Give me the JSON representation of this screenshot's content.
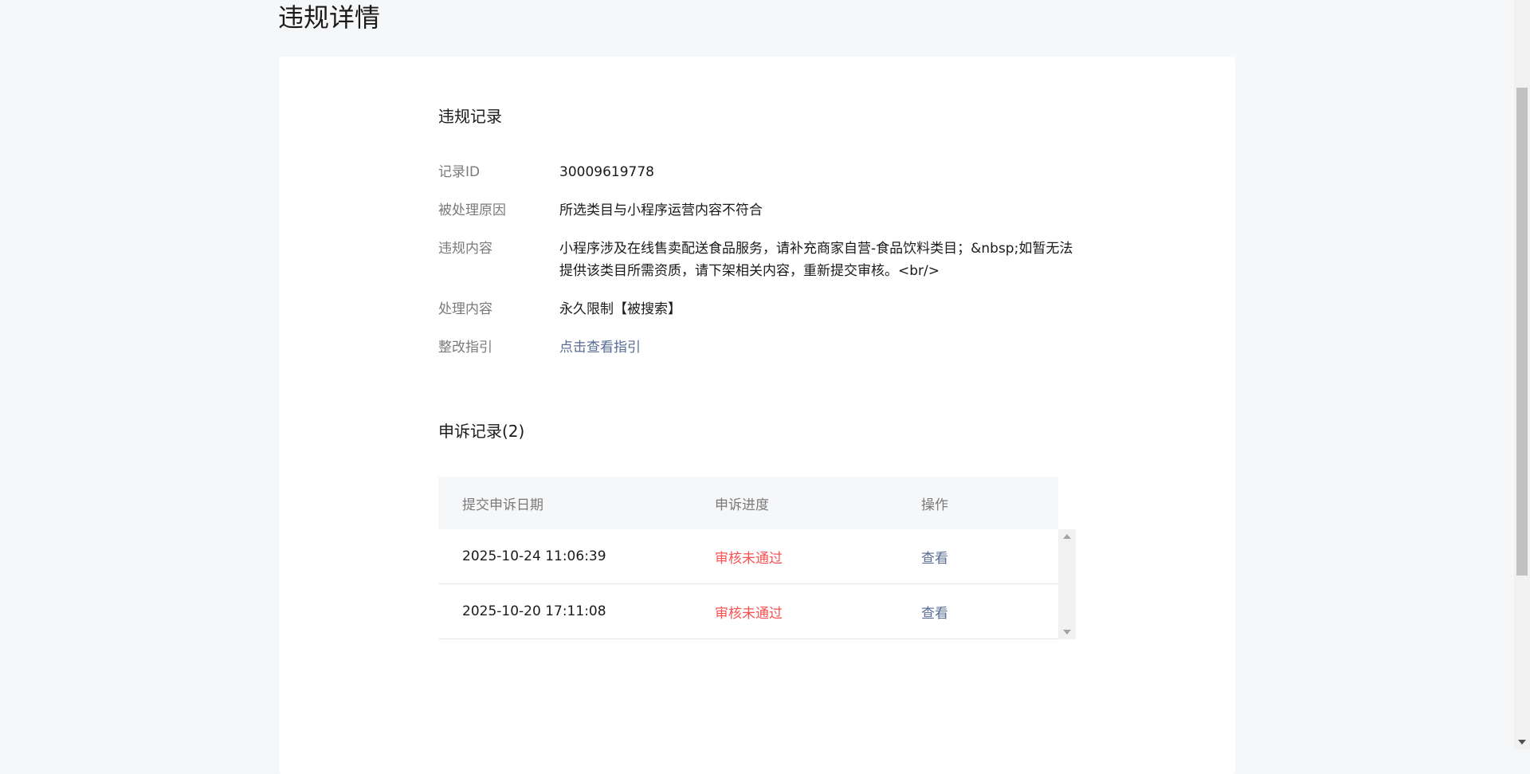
{
  "page": {
    "title": "违规详情"
  },
  "violation": {
    "section_title": "违规记录",
    "rows": [
      {
        "label": "记录ID",
        "value": "30009619778"
      },
      {
        "label": "被处理原因",
        "value": "所选类目与小程序运营内容不符合"
      },
      {
        "label": "违规内容",
        "value": "小程序涉及在线售卖配送食品服务，请补充商家自营-食品饮料类目；&nbsp;如暂无法提供该类目所需资质，请下架相关内容，重新提交审核。<br/>"
      },
      {
        "label": "处理内容",
        "value": "永久限制【被搜索】"
      },
      {
        "label": "整改指引",
        "value": "点击查看指引"
      }
    ]
  },
  "appeals": {
    "section_title": "申诉记录(2)",
    "columns": [
      "提交申诉日期",
      "申诉进度",
      "操作"
    ],
    "rows": [
      {
        "date": "2025-10-24 11:06:39",
        "status": "审核未通过",
        "action": "查看"
      },
      {
        "date": "2025-10-20 17:11:08",
        "status": "审核未通过",
        "action": "查看"
      }
    ]
  },
  "colors": {
    "link": "#576b95",
    "status_fail": "#fa5151",
    "background": "#f6f7f9"
  }
}
